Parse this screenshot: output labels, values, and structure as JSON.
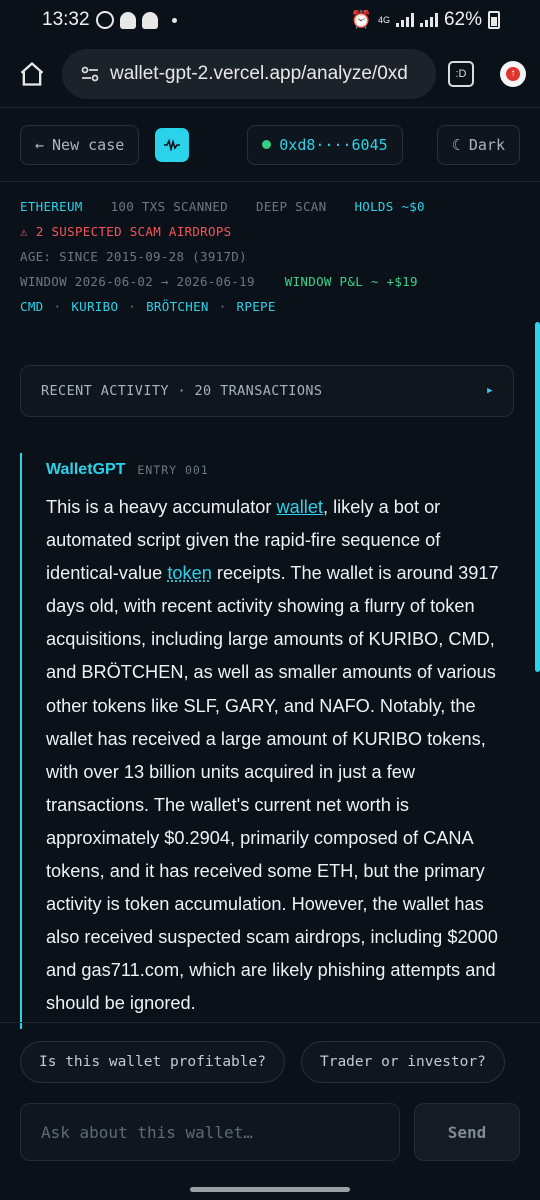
{
  "status_bar": {
    "time": "13:32",
    "network": "4G",
    "battery": "62%"
  },
  "browser": {
    "url": "wallet-gpt-2.vercel.app/analyze/0xd",
    "tab_label": ":D"
  },
  "header": {
    "new_case": "New case",
    "address": "0xd8····6045",
    "theme": "Dark"
  },
  "meta": {
    "chain": "ETHEREUM",
    "txs": "100 TXS SCANNED",
    "scan": "DEEP SCAN",
    "holds": "HOLDS ~$0",
    "warning": "2 SUSPECTED SCAM AIRDROPS",
    "age": "AGE: SINCE 2015-09-28 (3917D)",
    "window": "WINDOW 2026-06-02 → 2026-06-19",
    "pnl": "WINDOW P&L ~ +$19",
    "tokens": [
      "CMD",
      "KURIBO",
      "BRÖTCHEN",
      "RPEPE"
    ]
  },
  "activity": {
    "label": "RECENT ACTIVITY · 20 TRANSACTIONS"
  },
  "entry": {
    "name": "WalletGPT",
    "tag": "ENTRY 001",
    "p1": "This is a heavy accumulator ",
    "link1": "wallet",
    "p2": ", likely a bot or automated script given the rapid-fire sequence of identical-value ",
    "link2": "token",
    "p3": " receipts. The wallet is around 3917 days old, with recent activity showing a flurry of token acquisitions, including large amounts of KURIBO, CMD, and BRÖTCHEN, as well as smaller amounts of various other tokens like SLF, GARY, and NAFO. Notably, the wallet has received a large amount of KURIBO tokens, with over 13 billion units acquired in just a few transactions. The wallet's current net worth is approximately $0.2904, primarily composed of CANA tokens, and it has received some ETH, but the primary activity is token accumulation. However, the wallet has also received suspected scam airdrops, including $2000 and gas711.com, which are likely phishing attempts and should be ignored."
  },
  "suggestions": [
    "Is this wallet profitable?",
    "Trader or investor?"
  ],
  "ask": {
    "placeholder": "Ask about this wallet…",
    "send": "Send"
  },
  "colors": {
    "accent": "#2ad2ea",
    "danger": "#f2555a",
    "positive": "#3ad28b",
    "background": "#0b1118"
  }
}
